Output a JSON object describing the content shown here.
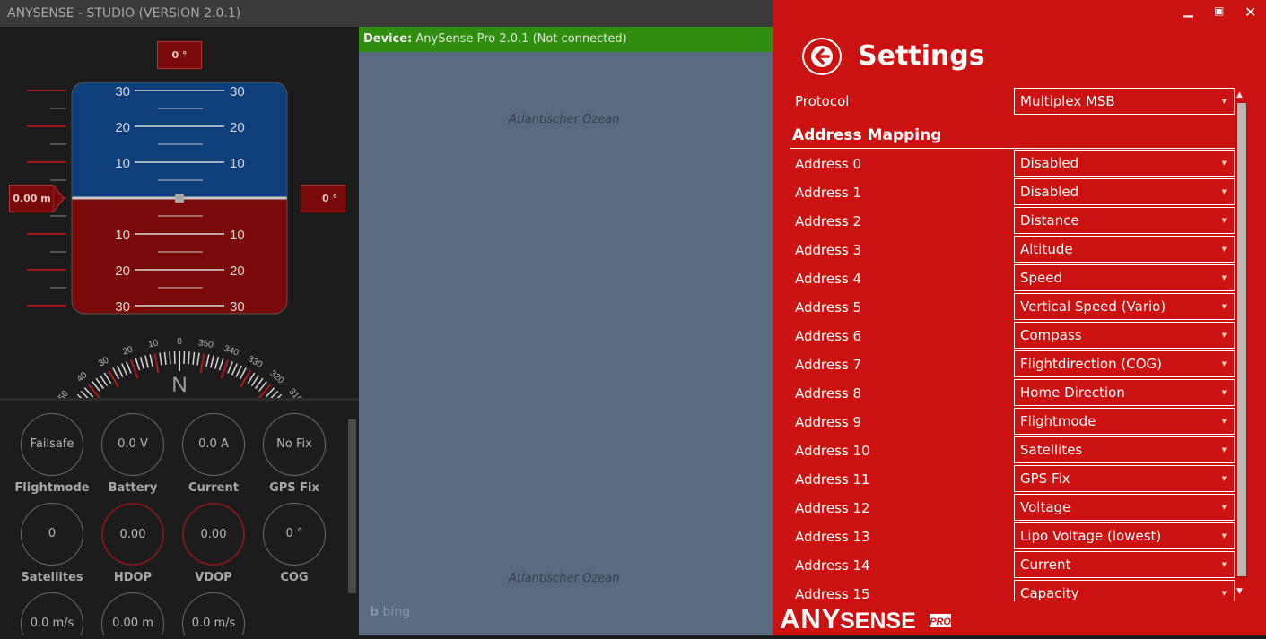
{
  "app": {
    "title": "ANYSENSE - STUDIO (VERSION 2.0.1)"
  },
  "attitude": {
    "pitch_top": "0 °",
    "altitude": "0.00 m",
    "roll_right": "0 °",
    "ladder_labels": [
      "30",
      "20",
      "10",
      "10",
      "20",
      "30"
    ],
    "compass_center": "N",
    "compass_ticks": [
      "50",
      "40",
      "30",
      "20",
      "10",
      "0",
      "350",
      "340",
      "330",
      "320",
      "310"
    ]
  },
  "gauges": [
    {
      "value": "Failsafe",
      "label": "Flightmode",
      "accent": false
    },
    {
      "value": "0.0 V",
      "label": "Battery",
      "accent": false
    },
    {
      "value": "0.0 A",
      "label": "Current",
      "accent": false
    },
    {
      "value": "No Fix",
      "label": "GPS Fix",
      "accent": false
    },
    {
      "value": "0",
      "label": "Satellites",
      "accent": false
    },
    {
      "value": "0.00",
      "label": "HDOP",
      "accent": true
    },
    {
      "value": "0.00",
      "label": "VDOP",
      "accent": true
    },
    {
      "value": "0 °",
      "label": "COG",
      "accent": false
    },
    {
      "value": "0.0 m/s",
      "label": "",
      "accent": false
    },
    {
      "value": "0.00 m",
      "label": "",
      "accent": false
    },
    {
      "value": "0.0 m/s",
      "label": "",
      "accent": false
    }
  ],
  "map": {
    "device_label": "Device:",
    "device_value": "AnySense Pro 2.0.1 (Not connected)",
    "ocean_top": "Atlantischer Ozean",
    "ocean_bottom": "Atlantischer Ozean",
    "watermark": "bing"
  },
  "settings": {
    "title": "Settings",
    "protocol_label": "Protocol",
    "protocol_value": "Multiplex MSB",
    "section_title": "Address Mapping",
    "addresses": [
      {
        "label": "Address 0",
        "value": "Disabled"
      },
      {
        "label": "Address 1",
        "value": "Disabled"
      },
      {
        "label": "Address 2",
        "value": "Distance"
      },
      {
        "label": "Address 3",
        "value": "Altitude"
      },
      {
        "label": "Address 4",
        "value": "Speed"
      },
      {
        "label": "Address 5",
        "value": "Vertical Speed (Vario)"
      },
      {
        "label": "Address 6",
        "value": "Compass"
      },
      {
        "label": "Address 7",
        "value": "Flightdirection (COG)"
      },
      {
        "label": "Address 8",
        "value": "Home Direction"
      },
      {
        "label": "Address 9",
        "value": "Flightmode"
      },
      {
        "label": "Address 10",
        "value": "Satellites"
      },
      {
        "label": "Address 11",
        "value": "GPS Fix"
      },
      {
        "label": "Address 12",
        "value": "Voltage"
      },
      {
        "label": "Address 13",
        "value": "Lipo Voltage (lowest)"
      },
      {
        "label": "Address 14",
        "value": "Current"
      },
      {
        "label": "Address 15",
        "value": "Capacity"
      }
    ],
    "logo": {
      "main": "ANYSENSE",
      "badge": "PRO"
    }
  },
  "colors": {
    "settings_bg": "#cc1111",
    "device_bar": "#2f8d10",
    "sky": "#0d3f7a",
    "ground": "#7a0a0a",
    "map_bg": "#5a6a80"
  },
  "icons": {
    "back": "arrow-left-icon",
    "minimize": "minimize-icon",
    "maximize": "maximize-icon",
    "close": "close-icon",
    "dropdown": "chevron-down-icon"
  }
}
